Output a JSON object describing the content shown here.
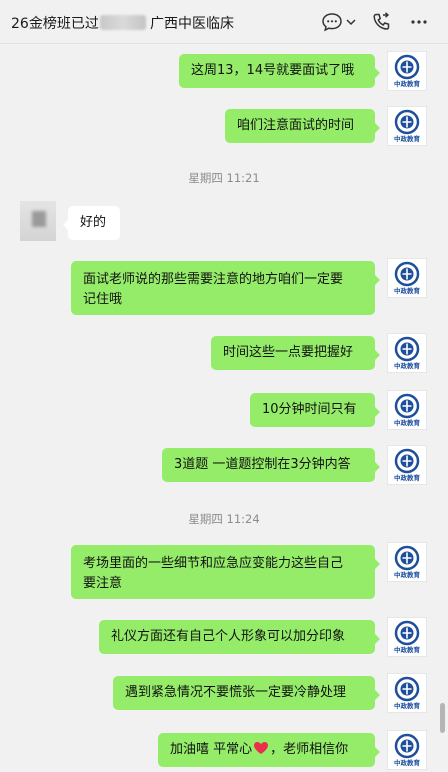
{
  "header": {
    "title_prefix": "26金榜班已过",
    "title_suffix": "广西中医临床",
    "icons": [
      "chat-icon",
      "chevron-down-icon",
      "phone-icon",
      "more-icon"
    ]
  },
  "avatar_caption": "中政教育",
  "messages": [
    {
      "id": "m1",
      "side": "right",
      "text": "这周13，14号就要面试了哦"
    },
    {
      "id": "m2",
      "side": "right",
      "text": "咱们注意面试的时间"
    },
    {
      "id": "t1",
      "type": "time",
      "text": "星期四 11:21"
    },
    {
      "id": "m3",
      "side": "left",
      "text": "好的"
    },
    {
      "id": "m4",
      "side": "right",
      "line1": "面试老师说的那些需要注意的地方咱们一定要",
      "line2": "记住哦"
    },
    {
      "id": "m5",
      "side": "right",
      "text": "时间这些一点要把握好"
    },
    {
      "id": "m6",
      "side": "right",
      "text": "10分钟时间只有"
    },
    {
      "id": "m7",
      "side": "right",
      "text": "3道题 一道题控制在3分钟内答"
    },
    {
      "id": "t2",
      "type": "time",
      "text": "星期四 11:24"
    },
    {
      "id": "m8",
      "side": "right",
      "line1": "考场里面的一些细节和应急应变能力这些自己",
      "line2": "要注意"
    },
    {
      "id": "m9",
      "side": "right",
      "text": "礼仪方面还有自己个人形象可以加分印象"
    },
    {
      "id": "m10",
      "side": "right",
      "text": "遇到紧急情况不要慌张一定要冷静处理"
    },
    {
      "id": "m11",
      "side": "right",
      "text_a": "加油嘻 平常心",
      "emoji": "heart-icon",
      "text_b": "，老师相信你"
    }
  ],
  "colors": {
    "bubble_self": "#95ec69",
    "bubble_other": "#ffffff",
    "background": "#f1f1f1",
    "heart": "#e8304d",
    "logo": "#1e4f9c"
  }
}
